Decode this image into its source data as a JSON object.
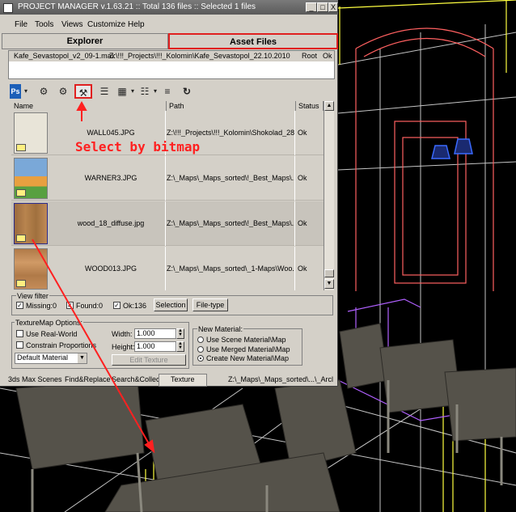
{
  "window": {
    "title": "PROJECT MANAGER v.1.63.21   :: Total 136 files  :: Selected 1 files",
    "minimize": "_",
    "maximize": "□",
    "close": "X"
  },
  "menu": [
    "File",
    "Tools",
    "Views",
    "Customize",
    "Help"
  ],
  "tabs": [
    {
      "label": "Explorer",
      "active": false
    },
    {
      "label": "Asset Files",
      "active": true
    }
  ],
  "scene_file": {
    "name": "Kafe_Sevastopol_v2_09-1.max",
    "path": "Z:\\!!!_Projects\\!!!_Kolomin\\Kafe_Sevastopol_22.10.2010",
    "type": "Root",
    "status": "Ok"
  },
  "toolbar": {
    "icons": [
      "photoshop-icon",
      "gear-pair-icon",
      "select-by-bitmap-icon",
      "list-add-icon",
      "thumbnails-view-icon",
      "details-view-icon",
      "list-view-icon",
      "refresh-icon"
    ]
  },
  "table": {
    "headers": [
      "Name",
      "Path",
      "Status"
    ],
    "rows": [
      {
        "name": "WALL045.JPG",
        "path": "Z:\\!!!_Projects\\!!!_Kolomin\\Shokolad_28...",
        "status": "Ok",
        "selected": false,
        "thumb": "#e8e4d8"
      },
      {
        "name": "WARNER3.JPG",
        "path": "Z:\\_Maps\\_Maps_sorted\\!_Best_Maps\\...",
        "status": "Ok",
        "selected": false,
        "thumb": "#7aa8d8"
      },
      {
        "name": "wood_18_diffuse.jpg",
        "path": "Z:\\_Maps\\_Maps_sorted\\!_Best_Maps\\...",
        "status": "Ok",
        "selected": true,
        "thumb": "#a8784a"
      },
      {
        "name": "WOOD013.JPG",
        "path": "Z:\\_Maps\\_Maps_sorted\\_1-Maps\\Woo...",
        "status": "Ok",
        "selected": false,
        "thumb": "#c08a58"
      }
    ]
  },
  "view_filter": {
    "label": "View filter",
    "missing": "Missing:0",
    "found": "Found:0",
    "ok": "Ok:136",
    "selection_btn": "Selection",
    "filetype_btn": "File-type"
  },
  "texturemap": {
    "label": "TextureMap Options:",
    "use_realworld": "Use Real-World",
    "constrain": "Constrain Proportions",
    "material_select": "Default Material",
    "width_label": "Width:",
    "width_value": "1.000",
    "height_label": "Height:",
    "height_value": "1.000",
    "edit_texture": "Edit Texture"
  },
  "new_material": {
    "label": "New Material:",
    "options": [
      "Use Scene Material\\Map",
      "Use Merged Material\\Map",
      "Create New Material\\Map"
    ],
    "selected_index": 2
  },
  "bottom_tabs": [
    "3ds Max Scenes",
    "Find&Replace",
    "Search&Collect",
    "Texture"
  ],
  "status_path": "Z:\\_Maps\\_Maps_sorted\\...\\_Arcl",
  "annotation": "Select by bitmap"
}
